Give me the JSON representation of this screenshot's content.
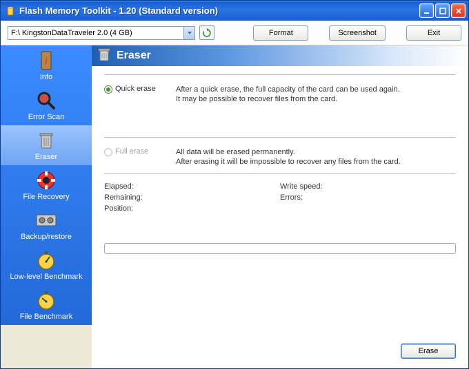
{
  "window": {
    "title": "Flash Memory Toolkit - 1.20 (Standard version)"
  },
  "toolbar": {
    "drive_selected": "F:\\ KingstonDataTraveler 2.0 (4 GB)",
    "format_label": "Format",
    "screenshot_label": "Screenshot",
    "exit_label": "Exit"
  },
  "sidebar": {
    "items": [
      {
        "label": "Info"
      },
      {
        "label": "Error Scan"
      },
      {
        "label": "Eraser"
      },
      {
        "label": "File Recovery"
      },
      {
        "label": "Backup/restore"
      },
      {
        "label": "Low-level Benchmark"
      },
      {
        "label": "File Benchmark"
      }
    ],
    "selected_index": 2
  },
  "main": {
    "title": "Eraser",
    "options": {
      "quick": {
        "label": "Quick erase",
        "desc_l1": "After a quick erase, the full capacity of the card can be used again.",
        "desc_l2": "It may be possible to recover files from the card.",
        "selected": true
      },
      "full": {
        "label": "Full erase",
        "desc_l1": "All data will be erased permanently.",
        "desc_l2": "After erasing it will be impossible to recover any files from the card.",
        "enabled": false
      }
    },
    "stats": {
      "elapsed_label": "Elapsed:",
      "remaining_label": "Remaining:",
      "position_label": "Position:",
      "writespeed_label": "Write speed:",
      "errors_label": "Errors:"
    },
    "erase_btn": "Erase"
  },
  "icons": {
    "app": "flash-icon",
    "refresh": "refresh-icon",
    "trash": "trash-icon"
  }
}
